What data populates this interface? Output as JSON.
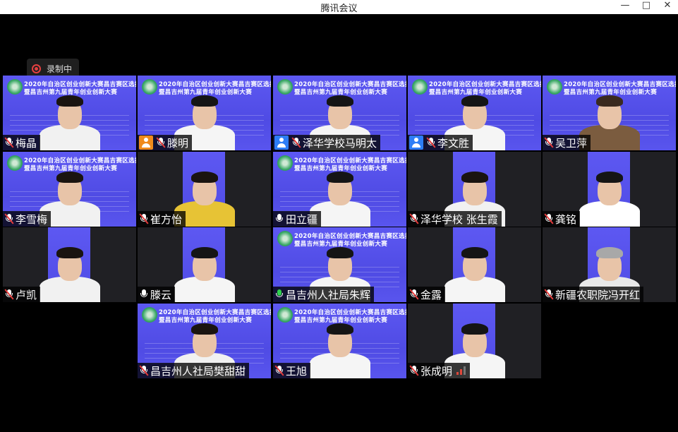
{
  "window": {
    "title": "腾讯会议",
    "controls": [
      "—",
      "□",
      "✕"
    ]
  },
  "recording": {
    "label": "录制中",
    "icon": "record-icon"
  },
  "banner": {
    "line1": "2020年自治区创业创新大赛昌吉赛区选拔赛",
    "line2": "暨昌吉州第九届青年创业创新大赛"
  },
  "participants": [
    {
      "name": "梅晶",
      "mic": "muted",
      "host": null
    },
    {
      "name": "滕明",
      "mic": "muted",
      "host": "orange"
    },
    {
      "name": "泽华学校马明太",
      "mic": "muted",
      "host": "blue"
    },
    {
      "name": "李文胜",
      "mic": "muted",
      "host": "blue"
    },
    {
      "name": "吴卫萍",
      "mic": "muted",
      "host": null
    },
    {
      "name": "李雪梅",
      "mic": "muted",
      "host": null
    },
    {
      "name": "崔方怡",
      "mic": "muted",
      "host": null
    },
    {
      "name": "田立疆",
      "mic": "on",
      "host": null
    },
    {
      "name": "泽华学校 张生霞",
      "mic": "muted",
      "host": null
    },
    {
      "name": "龚铭",
      "mic": "muted",
      "host": null
    },
    {
      "name": "卢凯",
      "mic": "muted",
      "host": null
    },
    {
      "name": "滕云",
      "mic": "on",
      "host": null
    },
    {
      "name": "昌吉州人社局朱辉",
      "mic": "speaking",
      "host": null
    },
    {
      "name": "金露",
      "mic": "muted",
      "host": null
    },
    {
      "name": "新疆农职院冯开红",
      "mic": "muted",
      "host": null
    },
    {
      "name": "昌吉州人社局樊甜甜",
      "mic": "muted",
      "host": null
    },
    {
      "name": "王旭",
      "mic": "muted",
      "host": null
    },
    {
      "name": "张成明",
      "mic": "muted",
      "host": null
    }
  ]
}
